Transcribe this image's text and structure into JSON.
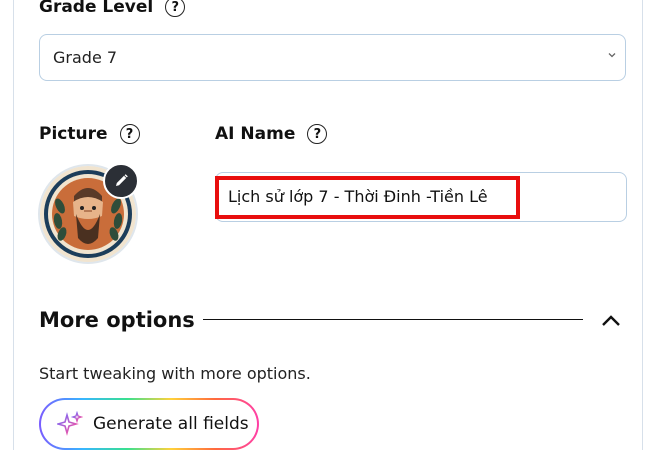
{
  "grade": {
    "label": "Grade Level",
    "help": "?",
    "value": "Grade 7"
  },
  "picture": {
    "label": "Picture",
    "help": "?"
  },
  "ai_name": {
    "label": "AI Name",
    "help": "?",
    "value": "Lịch sử lớp 7 - Thời Đinh -Tiền Lê"
  },
  "more_options": {
    "title": "More options",
    "hint": "Start tweaking with more options."
  },
  "generate_button": {
    "label": "Generate all fields"
  },
  "colors": {
    "highlight": "#e80e0e",
    "border": "#b9cfe3",
    "edit_bg": "#2b2f36"
  },
  "icons": [
    "help-icon",
    "chevron-down-icon",
    "pencil-icon",
    "chevron-up-icon",
    "sparkle-icon"
  ]
}
